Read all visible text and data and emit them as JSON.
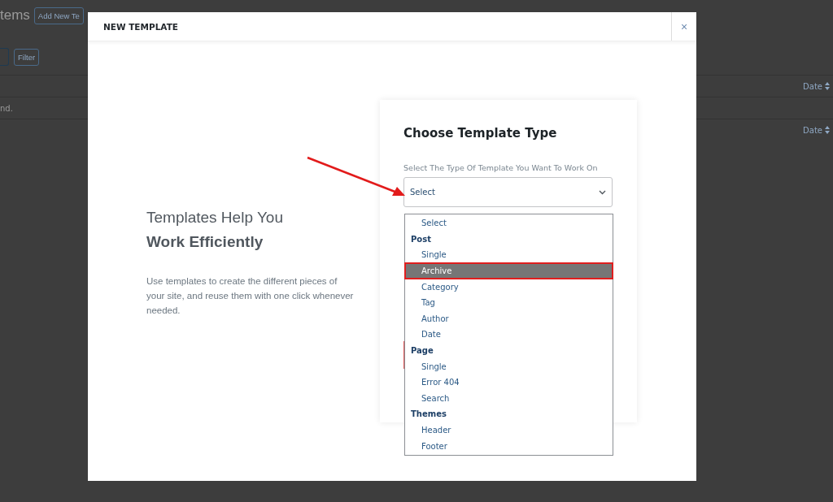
{
  "background": {
    "title": "tems",
    "add_button": "Add New Te",
    "filter_button": "Filter",
    "header_sort": "Date",
    "row_text": "nd.",
    "footer_sort": "Date"
  },
  "modal": {
    "title": "NEW TEMPLATE",
    "close": "×",
    "intro": {
      "heading_light": "Templates Help You",
      "heading_bold": "Work Efficiently",
      "description": "Use templates to create the different pieces of your site, and reuse them with one click whenever needed."
    },
    "form": {
      "heading": "Choose Template Type",
      "label": "Select The Type Of Template You Want To Work On",
      "select_value": "Select",
      "options": [
        {
          "kind": "option",
          "label": "Select",
          "selected": false
        },
        {
          "kind": "group",
          "label": "Post"
        },
        {
          "kind": "option",
          "label": "Single",
          "selected": false
        },
        {
          "kind": "option",
          "label": "Archive",
          "selected": true
        },
        {
          "kind": "option",
          "label": "Category",
          "selected": false
        },
        {
          "kind": "option",
          "label": "Tag",
          "selected": false
        },
        {
          "kind": "option",
          "label": "Author",
          "selected": false
        },
        {
          "kind": "option",
          "label": "Date",
          "selected": false
        },
        {
          "kind": "group",
          "label": "Page"
        },
        {
          "kind": "option",
          "label": "Single",
          "selected": false
        },
        {
          "kind": "option",
          "label": "Error 404",
          "selected": false
        },
        {
          "kind": "option",
          "label": "Search",
          "selected": false
        },
        {
          "kind": "group",
          "label": "Themes"
        },
        {
          "kind": "option",
          "label": "Header",
          "selected": false
        },
        {
          "kind": "option",
          "label": "Footer",
          "selected": false
        }
      ]
    }
  }
}
